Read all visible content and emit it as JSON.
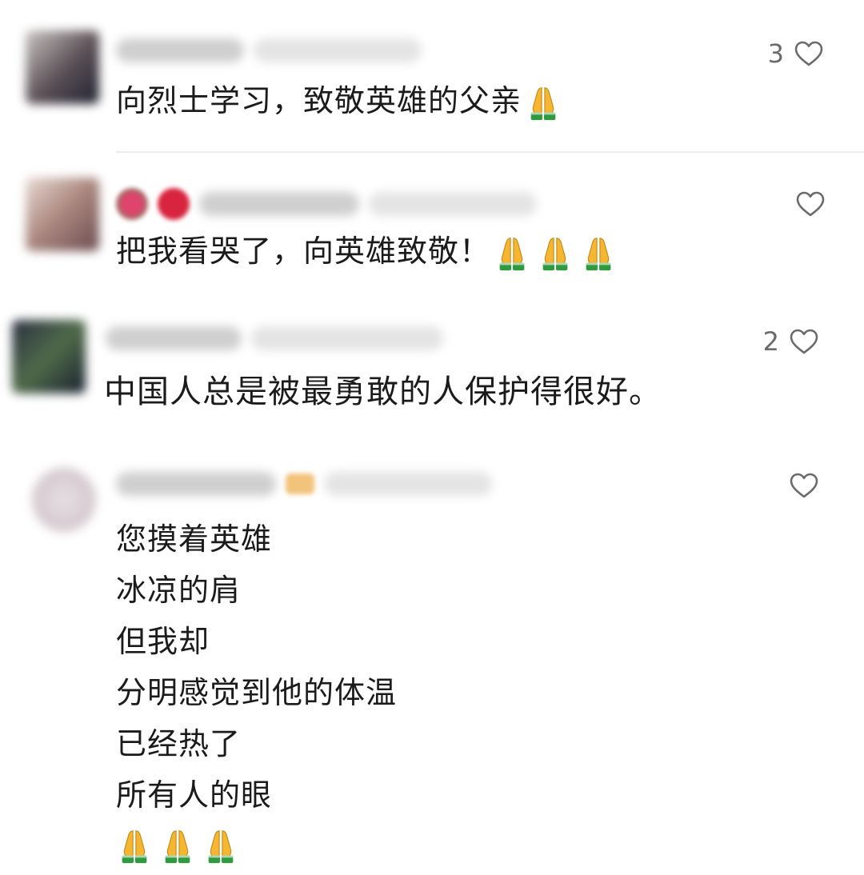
{
  "comments": [
    {
      "text": "向烈士学习，致敬英雄的父亲",
      "like_count": "3",
      "emoji_count": 1
    },
    {
      "text": "把我看哭了，向英雄致敬！",
      "like_count": "",
      "emoji_count": 3
    },
    {
      "text": "中国人总是被最勇敢的人保护得很好。",
      "like_count": "2",
      "emoji_count": 0
    },
    {
      "lines": [
        "您摸着英雄",
        "冰凉的肩",
        "但我却",
        "分明感觉到他的体温",
        "已经热了",
        "所有人的眼"
      ],
      "like_count": "",
      "emoji_count": 3
    }
  ],
  "icons": {
    "like": "heart-outline-icon",
    "emoji": "folded-hands-emoji"
  },
  "colors": {
    "text": "#1b1b1b",
    "like_text": "#6b6b6b",
    "divider": "#ececec",
    "emoji_skin": "#f5b731",
    "emoji_sleeve": "#2f9a3e"
  }
}
